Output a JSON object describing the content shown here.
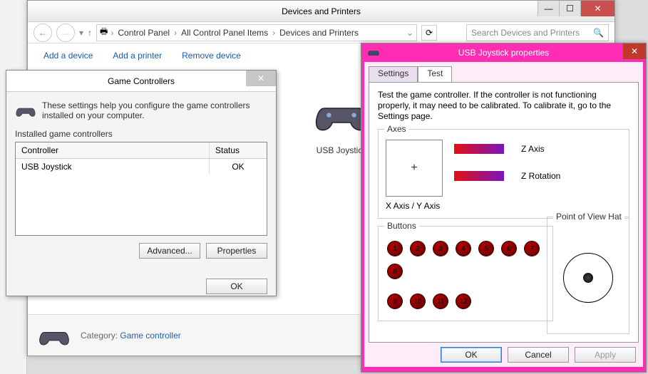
{
  "explorer": {
    "title": "Devices and Printers",
    "breadcrumbs": [
      "Control Panel",
      "All Control Panel Items",
      "Devices and Printers"
    ],
    "search_placeholder": "Search Devices and Printers",
    "toolbar": {
      "add_device": "Add a device",
      "add_printer": "Add a printer",
      "remove_device": "Remove device"
    },
    "device": {
      "name": "USB Joystick"
    },
    "details": {
      "category_label": "Category:",
      "category_value": "Game controller"
    }
  },
  "game_controllers": {
    "title": "Game Controllers",
    "intro": "These settings help you configure the game controllers installed on your computer.",
    "list_label": "Installed game controllers",
    "columns": {
      "controller": "Controller",
      "status": "Status"
    },
    "rows": [
      {
        "controller": "USB Joystick",
        "status": "OK"
      }
    ],
    "buttons": {
      "advanced": "Advanced...",
      "properties": "Properties",
      "ok": "OK"
    }
  },
  "props": {
    "title": "USB Joystick        properties",
    "tabs": {
      "settings": "Settings",
      "test": "Test"
    },
    "instructions": "Test the game controller.  If the controller is not functioning properly, it may need to be calibrated.  To calibrate it, go to the Settings page.",
    "axes": {
      "group": "Axes",
      "xy_caption": "X Axis / Y Axis",
      "z_axis": "Z Axis",
      "z_rotation": "Z Rotation"
    },
    "buttons_group": "Buttons",
    "button_numbers": [
      "1",
      "2",
      "3",
      "4",
      "5",
      "6",
      "7",
      "8",
      "9",
      "10",
      "11",
      "12"
    ],
    "pov_group": "Point of View Hat",
    "footer": {
      "ok": "OK",
      "cancel": "Cancel",
      "apply": "Apply"
    }
  }
}
